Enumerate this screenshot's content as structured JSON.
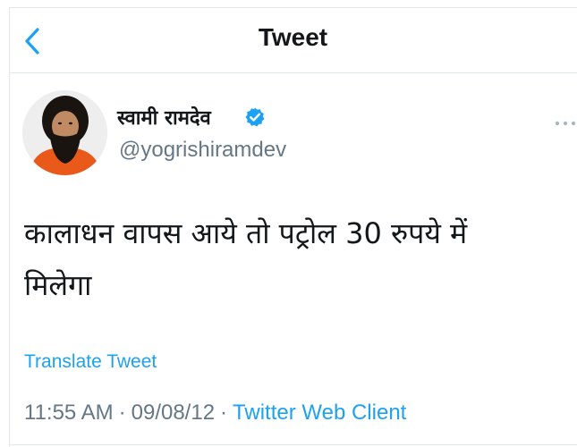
{
  "header": {
    "title": "Tweet",
    "back_icon": "chevron-left-icon"
  },
  "author": {
    "display_name": "स्वामी रामदेव",
    "handle": "@yogrishiramdev",
    "verified": true,
    "verified_icon": "verified-badge-icon",
    "more_icon": "more-dots-icon"
  },
  "tweet": {
    "text_line1": "कालाधन वापस आये तो पट्रोल 30 रुपये में",
    "text_line2": "मिलेगा",
    "translate_label": "Translate Tweet"
  },
  "meta": {
    "time": "11:55 AM",
    "separator": "·",
    "date": "09/08/12",
    "client": "Twitter Web Client"
  },
  "colors": {
    "accent": "#1da1f2",
    "text": "#14171a",
    "muted": "#657786",
    "divider": "#e1e8ed"
  }
}
